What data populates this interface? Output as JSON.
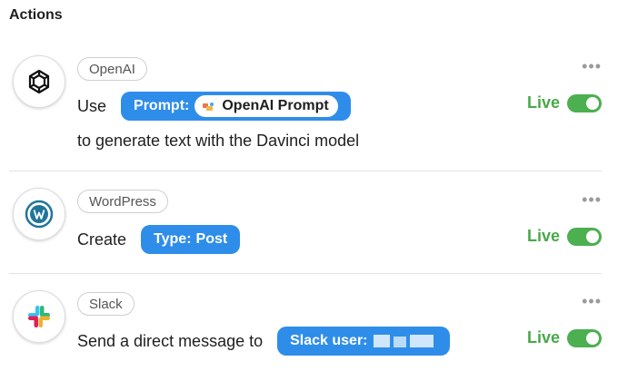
{
  "heading": "Actions",
  "actions": [
    {
      "app": "OpenAI",
      "icon": "openai-icon",
      "verb": "Use",
      "pill_key": "Prompt:",
      "pill_value": "OpenAI Prompt",
      "line2": "to generate text with the Davinci model",
      "status": "Live",
      "more": "•••"
    },
    {
      "app": "WordPress",
      "icon": "wordpress-icon",
      "verb": "Create",
      "pill_key": "Type:",
      "pill_value": "Post",
      "status": "Live",
      "more": "•••"
    },
    {
      "app": "Slack",
      "icon": "slack-icon",
      "verb": "Send a direct message to",
      "pill_key": "Slack user:",
      "status": "Live",
      "more": "•••"
    }
  ],
  "colors": {
    "pill": "#2f8dea",
    "live": "#4aa84a",
    "toggle": "#4caf50"
  }
}
